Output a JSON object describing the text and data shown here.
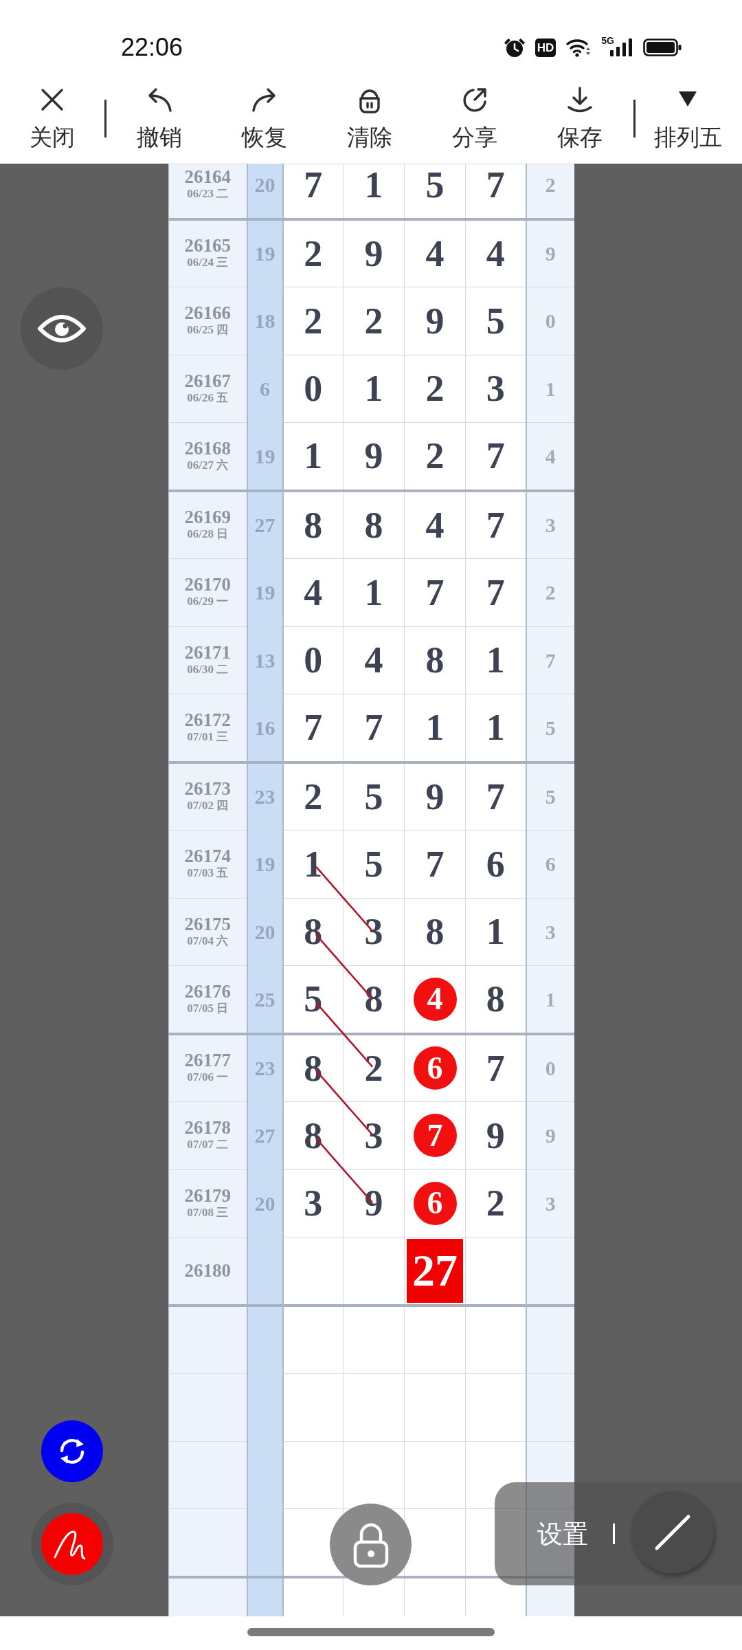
{
  "status_bar": {
    "time": "22:06",
    "hd_label": "HD",
    "network": "5G"
  },
  "toolbar": {
    "items": [
      {
        "kind": "close",
        "label": "关闭"
      },
      {
        "kind": "undo",
        "label": "撤销"
      },
      {
        "kind": "redo",
        "label": "恢复"
      },
      {
        "kind": "clear",
        "label": "清除"
      },
      {
        "kind": "share",
        "label": "分享"
      },
      {
        "kind": "save",
        "label": "保存"
      }
    ],
    "selector": {
      "label": "排列五"
    }
  },
  "table": {
    "rows": [
      {
        "issue": "26164",
        "date": "06/23 二",
        "sum": "20",
        "digits": [
          {
            "value": "7",
            "kind": "plain"
          },
          {
            "value": "1",
            "kind": "plain"
          },
          {
            "value": "5",
            "kind": "plain"
          },
          {
            "value": "7",
            "kind": "plain"
          }
        ],
        "column_7": "2",
        "linked": false
      },
      {
        "issue": "26165",
        "date": "06/24 三",
        "sum": "19",
        "digits": [
          {
            "value": "2",
            "kind": "plain"
          },
          {
            "value": "9",
            "kind": "plain"
          },
          {
            "value": "4",
            "kind": "plain"
          },
          {
            "value": "4",
            "kind": "plain"
          }
        ],
        "column_7": "9",
        "linked": false
      },
      {
        "issue": "26166",
        "date": "06/25 四",
        "sum": "18",
        "digits": [
          {
            "value": "2",
            "kind": "plain"
          },
          {
            "value": "2",
            "kind": "plain"
          },
          {
            "value": "9",
            "kind": "plain"
          },
          {
            "value": "5",
            "kind": "plain"
          }
        ],
        "column_7": "0",
        "linked": false
      },
      {
        "issue": "26167",
        "date": "06/26 五",
        "sum": "6",
        "digits": [
          {
            "value": "0",
            "kind": "plain"
          },
          {
            "value": "1",
            "kind": "plain"
          },
          {
            "value": "2",
            "kind": "plain"
          },
          {
            "value": "3",
            "kind": "plain"
          }
        ],
        "column_7": "1",
        "linked": false
      },
      {
        "issue": "26168",
        "date": "06/27 六",
        "sum": "19",
        "digits": [
          {
            "value": "1",
            "kind": "plain"
          },
          {
            "value": "9",
            "kind": "plain"
          },
          {
            "value": "2",
            "kind": "plain"
          },
          {
            "value": "7",
            "kind": "plain"
          }
        ],
        "column_7": "4",
        "linked": false
      },
      {
        "issue": "26169",
        "date": "06/28 日",
        "sum": "27",
        "digits": [
          {
            "value": "8",
            "kind": "plain"
          },
          {
            "value": "8",
            "kind": "plain"
          },
          {
            "value": "4",
            "kind": "plain"
          },
          {
            "value": "7",
            "kind": "plain"
          }
        ],
        "column_7": "3",
        "linked": false
      },
      {
        "issue": "26170",
        "date": "06/29 一",
        "sum": "19",
        "digits": [
          {
            "value": "4",
            "kind": "plain"
          },
          {
            "value": "1",
            "kind": "plain"
          },
          {
            "value": "7",
            "kind": "plain"
          },
          {
            "value": "7",
            "kind": "plain"
          }
        ],
        "column_7": "2",
        "linked": false
      },
      {
        "issue": "26171",
        "date": "06/30 二",
        "sum": "13",
        "digits": [
          {
            "value": "0",
            "kind": "plain"
          },
          {
            "value": "4",
            "kind": "plain"
          },
          {
            "value": "8",
            "kind": "plain"
          },
          {
            "value": "1",
            "kind": "plain"
          }
        ],
        "column_7": "7",
        "linked": false
      },
      {
        "issue": "26172",
        "date": "07/01 三",
        "sum": "16",
        "digits": [
          {
            "value": "7",
            "kind": "plain"
          },
          {
            "value": "7",
            "kind": "plain"
          },
          {
            "value": "1",
            "kind": "plain"
          },
          {
            "value": "1",
            "kind": "plain"
          }
        ],
        "column_7": "5",
        "linked": false
      },
      {
        "issue": "26173",
        "date": "07/02 四",
        "sum": "23",
        "digits": [
          {
            "value": "2",
            "kind": "plain"
          },
          {
            "value": "5",
            "kind": "plain"
          },
          {
            "value": "9",
            "kind": "plain"
          },
          {
            "value": "7",
            "kind": "plain"
          }
        ],
        "column_7": "5",
        "linked": false
      },
      {
        "issue": "26174",
        "date": "07/03 五",
        "sum": "19",
        "digits": [
          {
            "value": "1",
            "kind": "plain"
          },
          {
            "value": "5",
            "kind": "plain"
          },
          {
            "value": "7",
            "kind": "plain"
          },
          {
            "value": "6",
            "kind": "plain"
          }
        ],
        "column_7": "6",
        "linked": true
      },
      {
        "issue": "26175",
        "date": "07/04 六",
        "sum": "20",
        "digits": [
          {
            "value": "8",
            "kind": "plain"
          },
          {
            "value": "3",
            "kind": "plain"
          },
          {
            "value": "8",
            "kind": "plain"
          },
          {
            "value": "1",
            "kind": "plain"
          }
        ],
        "column_7": "3",
        "linked": true
      },
      {
        "issue": "26176",
        "date": "07/05 日",
        "sum": "25",
        "digits": [
          {
            "value": "5",
            "kind": "plain"
          },
          {
            "value": "8",
            "kind": "plain"
          },
          {
            "value": "4",
            "kind": "circle"
          },
          {
            "value": "8",
            "kind": "plain"
          }
        ],
        "column_7": "1",
        "linked": true
      },
      {
        "issue": "26177",
        "date": "07/06 一",
        "sum": "23",
        "digits": [
          {
            "value": "8",
            "kind": "plain"
          },
          {
            "value": "2",
            "kind": "plain"
          },
          {
            "value": "6",
            "kind": "circle"
          },
          {
            "value": "7",
            "kind": "plain"
          }
        ],
        "column_7": "0",
        "linked": true
      },
      {
        "issue": "26178",
        "date": "07/07 二",
        "sum": "27",
        "digits": [
          {
            "value": "8",
            "kind": "plain"
          },
          {
            "value": "3",
            "kind": "plain"
          },
          {
            "value": "7",
            "kind": "circle"
          },
          {
            "value": "9",
            "kind": "plain"
          }
        ],
        "column_7": "9",
        "linked": true
      },
      {
        "issue": "26179",
        "date": "07/08 三",
        "sum": "20",
        "digits": [
          {
            "value": "3",
            "kind": "plain"
          },
          {
            "value": "9",
            "kind": "plain"
          },
          {
            "value": "6",
            "kind": "circle"
          },
          {
            "value": "2",
            "kind": "plain"
          }
        ],
        "column_7": "3",
        "linked": false
      },
      {
        "issue": "26180",
        "digits": [
          {
            "kind": "blank"
          },
          {
            "kind": "blank"
          },
          {
            "value": "27",
            "kind": "box"
          },
          {
            "kind": "blank"
          }
        ],
        "linked": false
      }
    ]
  },
  "settings_panel": {
    "label": "设置"
  }
}
